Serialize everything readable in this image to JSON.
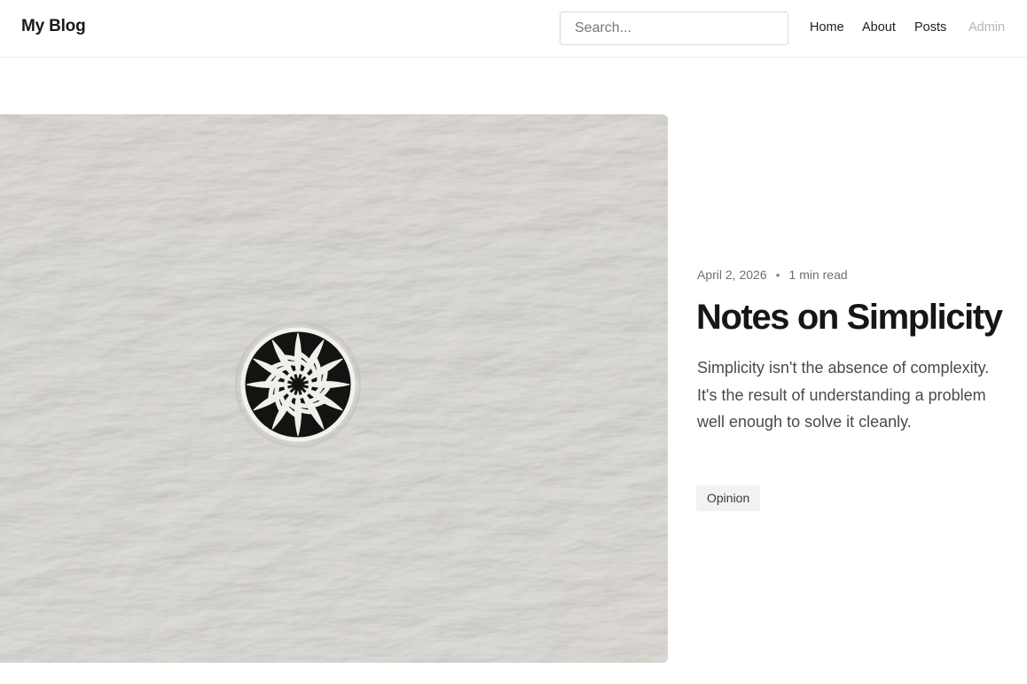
{
  "header": {
    "brand": "My Blog",
    "search_placeholder": "Search...",
    "nav": {
      "home": "Home",
      "about": "About",
      "posts": "Posts",
      "admin": "Admin"
    }
  },
  "post": {
    "date": "April 2, 2026",
    "separator": "•",
    "read_time": "1 min read",
    "title": "Notes on Simplicity",
    "excerpt": "Simplicity isn't the absence of complexity. It's the result of understanding a problem well enough to solve it cleanly.",
    "tag": "Opinion"
  },
  "colors": {
    "text_primary": "#1a1a1a",
    "text_muted": "#707070",
    "nav_disabled": "#b5b5b5",
    "tag_background": "#f2f2f2",
    "header_border": "#ececec",
    "image_wall": "#e9e7e4"
  }
}
